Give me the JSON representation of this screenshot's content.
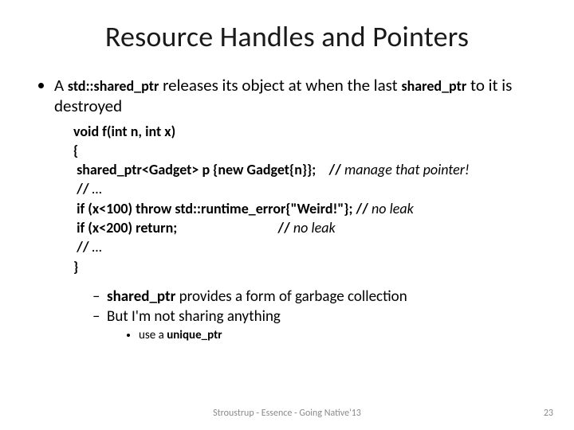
{
  "title": "Resource Handles and Pointers",
  "bullets": {
    "intro": {
      "part1": "A ",
      "code1": "std::shared_ptr",
      "part2": " releases its object at when the last ",
      "code2": "shared_ptr",
      "part3": " to it is destroyed"
    },
    "sub1": {
      "bold": "shared_ptr",
      "rest": " provides a form of garbage collection"
    },
    "sub2": "But I'm not sharing anything",
    "sub2sub": {
      "pre": "use a",
      "bold": "unique_ptr"
    }
  },
  "code": {
    "l1": "void f(int n, int x)",
    "l2": "{",
    "l3a": "shared_ptr<Gadget> p {new Gadget{n}};",
    "l3b_slash": "//",
    "l3b": "manage that pointer!",
    "l4a": "//",
    "l4b": "…",
    "l5a": "if (x<100) throw std::runtime_error{\"Weird!\"};",
    "l5b_slash": "//",
    "l5b": "no leak",
    "l6a": "if (x<200) return;",
    "l6b_slash": "//",
    "l6b": "no leak",
    "l7a": "//",
    "l7b": "…",
    "l8": "}"
  },
  "footer": "Stroustrup - Essence - Going Native'13",
  "page": "23"
}
